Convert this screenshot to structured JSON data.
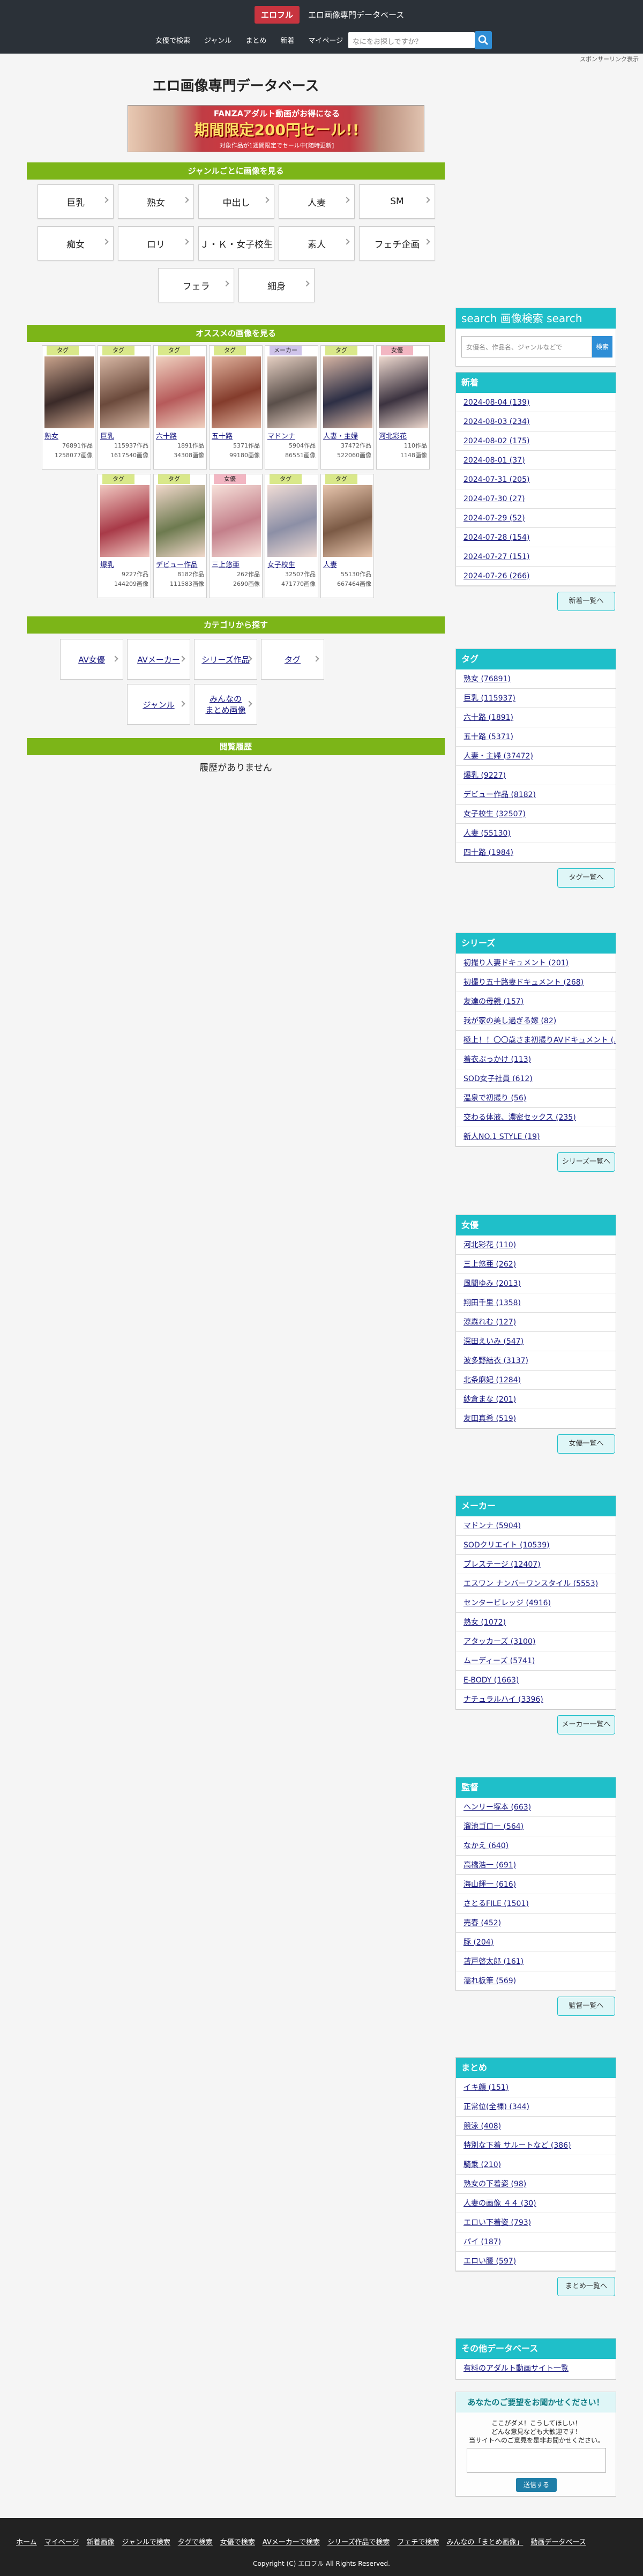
{
  "header": {
    "logo_badge": "エロフル",
    "logo_text": "エロ画像専門データベース",
    "nav": [
      "女優で検索",
      "ジャンル",
      "まとめ",
      "新着",
      "マイページ"
    ],
    "search_placeholder": "なにをお探しですか？",
    "sponsor_link": "スポンサーリンク表示"
  },
  "page_title": "エロ画像専門データベース",
  "banner": {
    "top": "FANZAアダルト動画がお得になる",
    "main": "期間限定200円セール!!",
    "sub": "対象作品が1週間限定でセール中[随時更新]"
  },
  "genre_section": {
    "title": "ジャンルごとに画像を見る",
    "buttons": [
      "巨乳",
      "熟女",
      "中出し",
      "人妻",
      "SM",
      "痴女",
      "ロリ",
      "Ｊ・Ｋ・女子校生",
      "素人",
      "フェチ企画",
      "フェラ",
      "細身"
    ]
  },
  "recommend_section": {
    "title": "オススメの画像を見る",
    "cards": [
      {
        "tag": "タグ",
        "tag_color": "#d9e88a",
        "name": "熟女",
        "works": "76891作品",
        "images": "1258077画像",
        "img": [
          "#3a2a28",
          "#c9a38c"
        ]
      },
      {
        "tag": "タグ",
        "tag_color": "#d9e88a",
        "name": "巨乳",
        "works": "115937作品",
        "images": "1617540画像",
        "img": [
          "#6b4a3c",
          "#d7b7a4"
        ]
      },
      {
        "tag": "タグ",
        "tag_color": "#d9e88a",
        "name": "六十路",
        "works": "1891作品",
        "images": "34308画像",
        "img": [
          "#b65a5a",
          "#f0d2c0"
        ]
      },
      {
        "tag": "タグ",
        "tag_color": "#d9e88a",
        "name": "五十路",
        "works": "5371作品",
        "images": "99180画像",
        "img": [
          "#843c2c",
          "#e0b19c"
        ]
      },
      {
        "tag": "メーカー",
        "tag_color": "#cfc4ea",
        "name": "マドンナ",
        "works": "5904作品",
        "images": "86551画像",
        "img": [
          "#5a4f4a",
          "#e5cfc2"
        ]
      },
      {
        "tag": "タグ",
        "tag_color": "#d9e88a",
        "name": "人妻・主婦",
        "works": "37472作品",
        "images": "522060画像",
        "img": [
          "#2d2f45",
          "#d6b4a3"
        ]
      },
      {
        "tag": "女優",
        "tag_color": "#f2b6c2",
        "name": "河北彩花",
        "works": "110作品",
        "images": "1148画像",
        "img": [
          "#3c3340",
          "#eed9cf"
        ]
      },
      {
        "tag": "タグ",
        "tag_color": "#d9e88a",
        "name": "爆乳",
        "works": "9227作品",
        "images": "144209画像",
        "img": [
          "#a83a48",
          "#f0c7c0"
        ]
      },
      {
        "tag": "タグ",
        "tag_color": "#d9e88a",
        "name": "デビュー作品",
        "works": "8182作品",
        "images": "111583画像",
        "img": [
          "#6d7a4f",
          "#f1d8cb"
        ]
      },
      {
        "tag": "女優",
        "tag_color": "#f2b6c2",
        "name": "三上悠亜",
        "works": "262作品",
        "images": "2690画像",
        "img": [
          "#c37f8a",
          "#f7e1da"
        ]
      },
      {
        "tag": "タグ",
        "tag_color": "#d9e88a",
        "name": "女子校生",
        "works": "32507作品",
        "images": "471770画像",
        "img": [
          "#8c8fa6",
          "#f0dcd5"
        ]
      },
      {
        "tag": "タグ",
        "tag_color": "#d9e88a",
        "name": "人妻",
        "works": "55130作品",
        "images": "667464画像",
        "img": [
          "#7b5a45",
          "#e7c5ad"
        ]
      }
    ]
  },
  "category_section": {
    "title": "カテゴリから探す",
    "buttons": [
      "AV女優",
      "AVメーカー",
      "シリーズ作品",
      "タグ",
      "ジャンル",
      "みんなの\nまとめ画像"
    ]
  },
  "history_section": {
    "title": "閲覧履歴",
    "empty": "履歴がありません"
  },
  "sidebar": {
    "search": {
      "title": "search 画像検索 search",
      "placeholder": "女優名、作品名、ジャンルなどで",
      "button": "検索"
    },
    "boxes": [
      {
        "title": "新着",
        "items": [
          "2024-08-04 (139)",
          "2024-08-03 (234)",
          "2024-08-02 (175)",
          "2024-08-01 (37)",
          "2024-07-31 (205)",
          "2024-07-30 (27)",
          "2024-07-29 (52)",
          "2024-07-28 (154)",
          "2024-07-27 (151)",
          "2024-07-26 (266)"
        ],
        "more": "新着一覧へ"
      },
      {
        "title": "タグ",
        "items": [
          "熟女 (76891)",
          "巨乳 (115937)",
          "六十路 (1891)",
          "五十路 (5371)",
          "人妻・主婦 (37472)",
          "爆乳 (9227)",
          "デビュー作品 (8182)",
          "女子校生 (32507)",
          "人妻 (55130)",
          "四十路 (1984)"
        ],
        "more": "タグ一覧へ"
      },
      {
        "title": "シリーズ",
        "items": [
          "初撮り人妻ドキュメント (201)",
          "初撮り五十路妻ドキュメント (268)",
          "友達の母親 (157)",
          "我が家の美し過ぎる嫁 (82)",
          "極上！！〇〇歳さま初撮りAVドキュメント (...)",
          "着衣ぶっかけ (113)",
          "SOD女子社員 (612)",
          "温泉で初撮り (56)",
          "交わる体液、濃密セックス (235)",
          "新人NO.1 STYLE (19)"
        ],
        "more": "シリーズ一覧へ"
      },
      {
        "title": "女優",
        "items": [
          "河北彩花 (110)",
          "三上悠亜 (262)",
          "風間ゆみ (2013)",
          "翔田千里 (1358)",
          "涼森れむ (127)",
          "深田えいみ (547)",
          "波多野結衣 (3137)",
          "北条麻妃 (1284)",
          "紗倉まな (201)",
          "友田真希 (519)"
        ],
        "more": "女優一覧へ"
      },
      {
        "title": "メーカー",
        "items": [
          "マドンナ (5904)",
          "SODクリエイト (10539)",
          "プレステージ (12407)",
          "エスワン ナンバーワンスタイル (5553)",
          "センタービレッジ (4916)",
          "熟女 (1072)",
          "アタッカーズ (3100)",
          "ムーディーズ (5741)",
          "E-BODY (1663)",
          "ナチュラルハイ (3396)"
        ],
        "more": "メーカー一覧へ"
      },
      {
        "title": "監督",
        "items": [
          "ヘンリー塚本 (663)",
          "溜池ゴロー (564)",
          "なかえ (640)",
          "高橋浩一 (691)",
          "海山輝一 (616)",
          "さとるFILE (1501)",
          "売春 (452)",
          "豚 (204)",
          "苫戸啓太郎 (161)",
          "濡れ板筆 (569)"
        ],
        "more": "監督一覧へ"
      },
      {
        "title": "まとめ",
        "items": [
          "イキ顔 (151)",
          "正常位(全裸) (344)",
          "競泳 (408)",
          "特別な下着 サルートなど (386)",
          "騎乗 (210)",
          "熟女の下着姿 (98)",
          "人妻の画像 ４４ (30)",
          "エロい下着姿 (793)",
          "パイ (187)",
          "エロい腰 (597)"
        ],
        "more": "まとめ一覧へ"
      }
    ],
    "other": {
      "title": "その他データベース",
      "item": "有料のアダルト動画サイト一覧"
    },
    "request": {
      "title": "あなたのご要望をお聞かせください！",
      "lines": [
        "ここがダメ！こうしてほしい！",
        "どんな意見なども大歓迎です！",
        "当サイトへのご意見を是非お聞かせください。"
      ],
      "button": "送信する"
    }
  },
  "footer": {
    "links": [
      "ホーム",
      "マイページ",
      "新着画像",
      "ジャンルで検索",
      "タグで検索",
      "女優で検索",
      "AVメーカーで検索",
      "シリーズ作品で検索",
      "フェチで検索",
      "みんなの「まとめ画像」",
      "動画データベース"
    ],
    "copyright": "Copyright (C) エロフル All Rights Reserved."
  }
}
